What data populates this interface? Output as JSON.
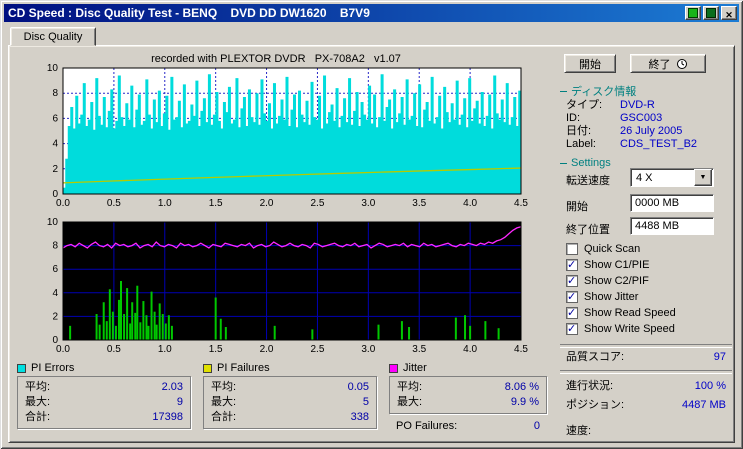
{
  "window": {
    "title": "CD Speed : Disc Quality Test - BENQ    DVD DD DW1620    B7V9"
  },
  "tab": {
    "label": "Disc Quality"
  },
  "chart_note": "recorded with PLEXTOR DVDR   PX-708A2   v1.07",
  "chart_data": [
    {
      "type": "area",
      "name": "pi-errors-scan",
      "x_range": [
        0,
        4.5
      ],
      "y_range": [
        0,
        10
      ],
      "x_ticks": [
        "0.0",
        "0.5",
        "1.0",
        "1.5",
        "2.0",
        "2.5",
        "3.0",
        "3.5",
        "4.0",
        "4.5"
      ],
      "y_ticks": [
        "10",
        "8",
        "6",
        "4",
        "2",
        "0"
      ],
      "bg": "#ffffff",
      "grid_color": "#2828c8",
      "grid_style": "dashed",
      "series": [
        {
          "name": "PI Errors",
          "type": "bars",
          "color": "#00dcdc",
          "values": [
            0.5,
            2.8,
            5.4,
            6.9,
            5.2,
            7.8,
            5.6,
            6.3,
            8.8,
            5.4,
            5.9,
            7.3,
            5.1,
            9.2,
            6.2,
            5.5,
            7.7,
            5.3,
            6.6,
            8.3,
            5.2,
            5.8,
            9.4,
            6.1,
            5.4,
            7.2,
            5.9,
            8.6,
            5.3,
            6.7,
            7.9,
            5.5,
            5.8,
            9.1,
            6.3,
            5.2,
            7.5,
            5.7,
            8.2,
            5.4,
            6.4,
            7.8,
            5.1,
            9.3,
            5.9,
            6.1,
            7.4,
            5.3,
            8.7,
            5.6,
            5.8,
            7.1,
            6.2,
            9.0,
            5.4,
            6.6,
            7.6,
            5.7,
            9.5,
            5.5,
            6.3,
            8.1,
            5.8,
            5.2,
            7.3,
            6.5,
            8.5,
            5.6,
            5.9,
            9.2,
            5.3,
            6.8,
            7.7,
            5.4,
            8.3,
            6.1,
            5.7,
            8.0,
            5.5,
            9.1,
            6.4,
            5.8,
            7.2,
            5.2,
            8.8,
            5.6,
            6.2,
            7.5,
            5.9,
            9.3,
            5.4,
            6.7,
            7.9,
            5.3,
            8.2,
            6.3,
            5.7,
            7.4,
            5.5,
            8.9,
            6.1,
            5.9,
            7.8,
            5.2,
            9.4,
            5.6,
            6.5,
            7.1,
            5.8,
            8.4,
            5.3,
            6.2,
            7.6,
            5.7,
            9.2,
            5.5,
            6.6,
            8.1,
            5.4,
            7.3,
            6.3,
            5.9,
            8.6,
            5.6,
            7.9,
            5.3,
            6.1,
            9.5,
            5.8,
            6.9,
            7.5,
            5.2,
            8.3,
            5.7,
            6.4,
            7.7,
            5.5,
            9.1,
            5.9,
            6.2,
            8.0,
            5.4,
            8.7,
            5.3,
            6.7,
            7.3,
            5.8,
            9.3,
            5.6,
            6.1,
            7.8,
            5.2,
            8.5,
            6.5,
            5.7,
            7.2,
            5.9,
            9.0,
            5.5,
            6.3,
            7.6,
            5.3,
            9.2,
            5.8,
            6.8,
            7.4,
            5.6,
            8.1,
            5.4,
            6.2,
            7.9,
            5.2,
            9.4,
            6.4,
            5.9,
            7.5,
            5.7,
            8.8,
            5.5,
            6.1,
            7.7,
            5.4,
            8.2
          ]
        },
        {
          "name": "Write Speed",
          "type": "line",
          "color": "#b4cc00",
          "x": [
            0,
            0.45,
            0.9,
            1.35,
            1.8,
            2.25,
            2.7,
            3.15,
            3.6,
            4.05,
            4.5
          ],
          "values": [
            0.88,
            1.02,
            1.15,
            1.28,
            1.4,
            1.52,
            1.63,
            1.74,
            1.85,
            1.95,
            2.06
          ]
        }
      ]
    },
    {
      "type": "line",
      "name": "pif-jitter-scan",
      "x_range": [
        0,
        4.5
      ],
      "y_range": [
        0,
        10
      ],
      "x_ticks": [
        "0.0",
        "0.5",
        "1.0",
        "1.5",
        "2.0",
        "2.5",
        "3.0",
        "3.5",
        "4.0",
        "4.5"
      ],
      "y_ticks": [
        "10",
        "8",
        "6",
        "4",
        "2",
        "0"
      ],
      "bg": "#000000",
      "grid_color": "#0000b4",
      "grid_style": "solid",
      "series": [
        {
          "name": "PI Failures",
          "type": "spikes",
          "color": "#00c800",
          "points": [
            [
              0.07,
              1.2
            ],
            [
              0.33,
              2.2
            ],
            [
              0.36,
              1.3
            ],
            [
              0.4,
              3.2
            ],
            [
              0.43,
              1.6
            ],
            [
              0.46,
              4.3
            ],
            [
              0.49,
              2.4
            ],
            [
              0.52,
              1.2
            ],
            [
              0.55,
              3.4
            ],
            [
              0.57,
              5.0
            ],
            [
              0.6,
              2.2
            ],
            [
              0.63,
              4.4
            ],
            [
              0.66,
              1.4
            ],
            [
              0.68,
              3.2
            ],
            [
              0.71,
              2.3
            ],
            [
              0.73,
              4.6
            ],
            [
              0.76,
              1.5
            ],
            [
              0.79,
              3.3
            ],
            [
              0.82,
              2.1
            ],
            [
              0.84,
              1.2
            ],
            [
              0.87,
              4.1
            ],
            [
              0.9,
              2.4
            ],
            [
              0.92,
              1.3
            ],
            [
              0.95,
              3.1
            ],
            [
              0.98,
              2.2
            ],
            [
              1.01,
              1.4
            ],
            [
              1.04,
              2.1
            ],
            [
              1.07,
              1.2
            ],
            [
              1.5,
              3.6
            ],
            [
              1.55,
              1.8
            ],
            [
              1.6,
              1.1
            ],
            [
              2.08,
              1.2
            ],
            [
              2.45,
              0.9
            ],
            [
              3.1,
              1.3
            ],
            [
              3.33,
              1.6
            ],
            [
              3.4,
              1.1
            ],
            [
              3.86,
              1.9
            ],
            [
              3.95,
              2.1
            ],
            [
              4.0,
              1.2
            ],
            [
              4.15,
              1.6
            ],
            [
              4.28,
              1.0
            ]
          ]
        },
        {
          "name": "Jitter",
          "type": "line",
          "color": "#ff28ff",
          "values": [
            7.8,
            8.0,
            8.1,
            7.9,
            8.2,
            8.0,
            7.8,
            8.1,
            8.3,
            8.0,
            7.9,
            8.1,
            7.8,
            8.2,
            8.0,
            8.1,
            7.9,
            8.0,
            8.2,
            7.8,
            8.0,
            8.1,
            7.9,
            8.3,
            8.0,
            7.9,
            8.1,
            8.0,
            7.8,
            8.2,
            8.0,
            8.1,
            7.9,
            8.0,
            8.2,
            8.0,
            7.8,
            8.1,
            8.0,
            7.9,
            8.2,
            8.1,
            8.0,
            7.9,
            8.1,
            8.0,
            8.2,
            7.8,
            8.0,
            8.1,
            7.9,
            8.0,
            8.3,
            8.1,
            7.9,
            8.0,
            8.2,
            8.0,
            7.9,
            8.1,
            8.0,
            7.8,
            8.2,
            8.1,
            7.9,
            8.0,
            8.1,
            8.2,
            8.0,
            7.9,
            8.1,
            8.0,
            8.2,
            7.9,
            8.0,
            8.1,
            7.8,
            8.0,
            8.2,
            8.1,
            7.9,
            8.0,
            8.1,
            8.0,
            8.2,
            7.9,
            8.1,
            8.0,
            7.9,
            8.2,
            8.0,
            8.1,
            7.9,
            8.0,
            8.1,
            8.2,
            8.0,
            7.9,
            8.1,
            8.0,
            8.2,
            8.1,
            8.0,
            8.2,
            8.1,
            8.3,
            8.2,
            8.4,
            8.5,
            8.7,
            9.0,
            9.3,
            9.5,
            9.6
          ]
        }
      ]
    }
  ],
  "legend_stats": {
    "pi_errors": {
      "label": "PI Errors",
      "swatch_color": "#00e0e0",
      "rows": [
        [
          "平均:",
          "2.03"
        ],
        [
          "最大:",
          "9"
        ],
        [
          "合計:",
          "17398"
        ]
      ]
    },
    "pi_failures": {
      "label": "PI Failures",
      "swatch_color": "#e0e000",
      "rows": [
        [
          "平均:",
          "0.05"
        ],
        [
          "最大:",
          "5"
        ],
        [
          "合計:",
          "338"
        ]
      ]
    },
    "jitter": {
      "label": "Jitter",
      "swatch_color": "#ff00ff",
      "rows": [
        [
          "平均:",
          "8.06 %"
        ],
        [
          "最大:",
          "9.9 %"
        ]
      ]
    },
    "po_failures": {
      "label": "PO Failures:",
      "value": "0"
    }
  },
  "sidebar": {
    "start_button": "開始",
    "stop_button": "終了",
    "disc_info": {
      "header": "ディスク情報",
      "rows": [
        {
          "label": "タイプ:",
          "value": "DVD-R"
        },
        {
          "label": "ID:",
          "value": "GSC003"
        },
        {
          "label": "日付:",
          "value": "26 July 2005"
        },
        {
          "label": "Label:",
          "value": "CDS_TEST_B2"
        }
      ]
    },
    "settings": {
      "header": "Settings",
      "speed_label": "転送速度",
      "speed_value": "4 X",
      "start_label": "開始",
      "start_value": "0000 MB",
      "end_label": "終了位置",
      "end_value": "4488 MB",
      "checkboxes": [
        {
          "label": "Quick Scan",
          "checked": false
        },
        {
          "label": "Show C1/PIE",
          "checked": true
        },
        {
          "label": "Show C2/PIF",
          "checked": true
        },
        {
          "label": "Show Jitter",
          "checked": true
        },
        {
          "label": "Show Read Speed",
          "checked": true
        },
        {
          "label": "Show Write Speed",
          "checked": true
        }
      ]
    },
    "quality_score": {
      "label": "品質スコア:",
      "value": "97"
    },
    "progress": {
      "label": "進行状況:",
      "value": "100 %"
    },
    "position": {
      "label": "ポジション:",
      "value": "4487 MB"
    },
    "speed": {
      "label": "速度:",
      "value": ""
    }
  }
}
